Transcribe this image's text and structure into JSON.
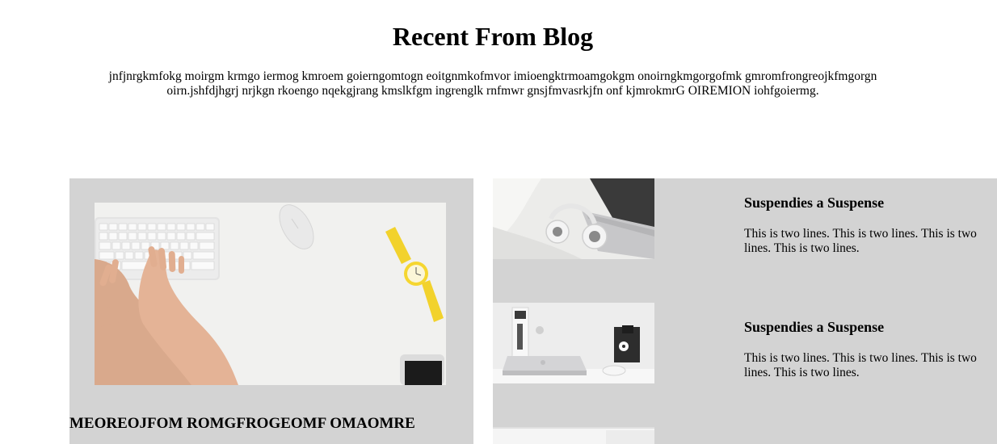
{
  "blog": {
    "title": "Recent From Blog",
    "intro": "jnfjnrgkmfokg moirgm krmgo iermog kmroem goierngomtogn eoitgnmkofmvor imioengktrmoamgokgm onoirngkmgorgofmk gmromfrongreojkfmgorgn oirn.jshfdjhgrj nrjkgn rkoengo nqekgjrang kmslkfgm ingrenglk rnfmwr gnsjfmvasrkjfn onf kjmrokmrG OIREMION iohfgoiermg."
  },
  "featured": {
    "title": "MEOREOJFOM ROMGFROGEOMF OMAOMRE",
    "image": "keyboard-watch-desk-photo"
  },
  "side_posts": [
    {
      "title": "Suspendies a Suspense",
      "text": "This is two lines. This is two lines. This is two lines. This is two lines.",
      "image": "headphones-laptop-photo"
    },
    {
      "title": "Suspendies a Suspense",
      "text": "This is two lines. This is two lines. This is two lines. This is two lines.",
      "image": "laptop-books-clock-photo"
    }
  ]
}
